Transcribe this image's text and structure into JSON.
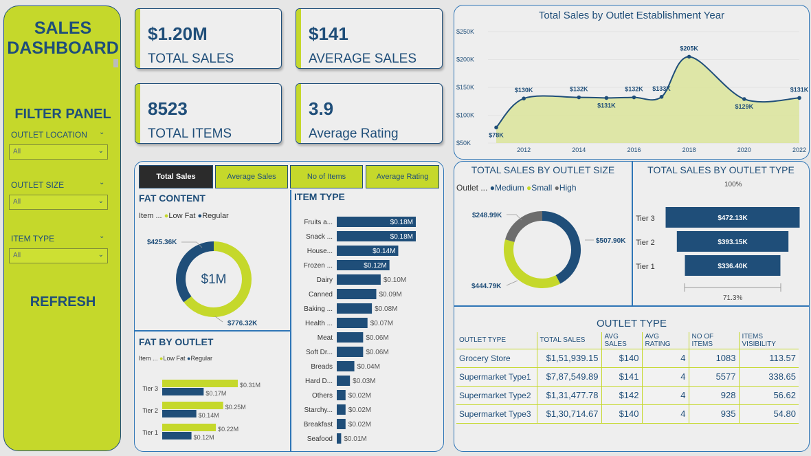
{
  "sidebar": {
    "title_line1": "SALES",
    "title_line2": "DASHBOARD",
    "filter_panel": "FILTER PANEL",
    "filters": [
      {
        "label": "OUTLET LOCATION",
        "value": "All"
      },
      {
        "label": "OUTLET SIZE",
        "value": "All"
      },
      {
        "label": "ITEM TYPE",
        "value": "All"
      }
    ],
    "refresh": "REFRESH"
  },
  "kpis": [
    {
      "value": "$1.20M",
      "label": "TOTAL SALES"
    },
    {
      "value": "$141",
      "label": "AVERAGE SALES"
    },
    {
      "value": "8523",
      "label": "TOTAL ITEMS"
    },
    {
      "value": "3.9",
      "label": "Average Rating"
    }
  ],
  "tabs": [
    "Total Sales",
    "Average Sales",
    "No of Items",
    "Average Rating"
  ],
  "fat_content": {
    "title": "FAT CONTENT",
    "legend_title": "Item ...",
    "legend": [
      "Low Fat",
      "Regular"
    ],
    "center": "$1M",
    "label_regular": "$425.36K",
    "label_lowfat": "$776.32K"
  },
  "fat_by_outlet": {
    "title": "FAT BY OUTLET",
    "legend_title": "Item ...",
    "legend": [
      "Low Fat",
      "Regular"
    ],
    "rows": [
      {
        "tier": "Tier 3",
        "lowfat": "$0.31M",
        "regular": "$0.17M"
      },
      {
        "tier": "Tier 2",
        "lowfat": "$0.25M",
        "regular": "$0.14M"
      },
      {
        "tier": "Tier 1",
        "lowfat": "$0.22M",
        "regular": "$0.12M"
      }
    ]
  },
  "item_type": {
    "title": "ITEM TYPE",
    "rows": [
      {
        "name": "Fruits a...",
        "value": "$0.18M"
      },
      {
        "name": "Snack ...",
        "value": "$0.18M"
      },
      {
        "name": "House...",
        "value": "$0.14M"
      },
      {
        "name": "Frozen ...",
        "value": "$0.12M"
      },
      {
        "name": "Dairy",
        "value": "$0.10M"
      },
      {
        "name": "Canned",
        "value": "$0.09M"
      },
      {
        "name": "Baking ...",
        "value": "$0.08M"
      },
      {
        "name": "Health ...",
        "value": "$0.07M"
      },
      {
        "name": "Meat",
        "value": "$0.06M"
      },
      {
        "name": "Soft Dr...",
        "value": "$0.06M"
      },
      {
        "name": "Breads",
        "value": "$0.04M"
      },
      {
        "name": "Hard D...",
        "value": "$0.03M"
      },
      {
        "name": "Others",
        "value": "$0.02M"
      },
      {
        "name": "Starchy...",
        "value": "$0.02M"
      },
      {
        "name": "Breakfast",
        "value": "$0.02M"
      },
      {
        "name": "Seafood",
        "value": "$0.01M"
      }
    ]
  },
  "line_chart": {
    "title": "Total Sales by Outlet Establishment Year",
    "y_ticks": [
      "$250K",
      "$200K",
      "$150K",
      "$100K",
      "$50K"
    ],
    "x_ticks": [
      "2012",
      "2014",
      "2016",
      "2018",
      "2020",
      "2022"
    ],
    "point_labels": [
      "$78K",
      "$130K",
      "$132K",
      "$131K",
      "$132K",
      "$133K",
      "$205K",
      "$129K",
      "$131K"
    ]
  },
  "outlet_size": {
    "title": "TOTAL SALES BY OUTLET SIZE",
    "legend_title": "Outlet ...",
    "legend": [
      "Medium",
      "Small",
      "High"
    ],
    "label_high": "$248.99K",
    "label_medium": "$507.90K",
    "label_small": "$444.79K"
  },
  "outlet_type_funnel": {
    "title": "TOTAL SALES BY OUTLET TYPE",
    "top_pct": "100%",
    "bottom_pct": "71.3%",
    "rows": [
      {
        "tier": "Tier 3",
        "value": "$472.13K"
      },
      {
        "tier": "Tier 2",
        "value": "$393.15K"
      },
      {
        "tier": "Tier 1",
        "value": "$336.40K"
      }
    ]
  },
  "outlet_table": {
    "title": "OUTLET TYPE",
    "headers": [
      "OUTLET TYPE",
      "TOTAL SALES",
      "AVG SALES",
      "AVG RATING",
      "NO OF ITEMS",
      "ITEMS VISIBILITY"
    ],
    "rows": [
      [
        "Grocery Store",
        "$1,51,939.15",
        "$140",
        "4",
        "1083",
        "113.57"
      ],
      [
        "Supermarket Type1",
        "$7,87,549.89",
        "$141",
        "4",
        "5577",
        "338.65"
      ],
      [
        "Supermarket Type2",
        "$1,31,477.78",
        "$142",
        "4",
        "928",
        "56.62"
      ],
      [
        "Supermarket Type3",
        "$1,30,714.67",
        "$140",
        "4",
        "935",
        "54.80"
      ]
    ]
  },
  "colors": {
    "accent": "#c5d82b",
    "navy": "#1f4e79",
    "grey": "#6d6d6d"
  },
  "chart_data": [
    {
      "type": "line",
      "title": "Total Sales by Outlet Establishment Year",
      "x": [
        2011,
        2012,
        2014,
        2015,
        2016,
        2017,
        2018,
        2020,
        2022
      ],
      "y": [
        78,
        130,
        132,
        131,
        132,
        133,
        205,
        129,
        131
      ],
      "ylim": [
        50,
        250
      ],
      "xlabel": "",
      "ylabel": ""
    },
    {
      "type": "pie",
      "title": "FAT CONTENT",
      "categories": [
        "Low Fat",
        "Regular"
      ],
      "values": [
        776.32,
        425.36
      ]
    },
    {
      "type": "pie",
      "title": "TOTAL SALES BY OUTLET SIZE",
      "categories": [
        "Medium",
        "Small",
        "High"
      ],
      "values": [
        507.9,
        444.79,
        248.99
      ]
    },
    {
      "type": "bar",
      "title": "ITEM TYPE",
      "categories": [
        "Fruits a...",
        "Snack ...",
        "House...",
        "Frozen ...",
        "Dairy",
        "Canned",
        "Baking ...",
        "Health ...",
        "Meat",
        "Soft Dr...",
        "Breads",
        "Hard D...",
        "Others",
        "Starchy...",
        "Breakfast",
        "Seafood"
      ],
      "values": [
        0.18,
        0.18,
        0.14,
        0.12,
        0.1,
        0.09,
        0.08,
        0.07,
        0.06,
        0.06,
        0.04,
        0.03,
        0.02,
        0.02,
        0.02,
        0.01
      ]
    },
    {
      "type": "bar",
      "title": "FAT BY OUTLET",
      "categories": [
        "Tier 3",
        "Tier 2",
        "Tier 1"
      ],
      "series": [
        {
          "name": "Low Fat",
          "values": [
            0.31,
            0.25,
            0.22
          ]
        },
        {
          "name": "Regular",
          "values": [
            0.17,
            0.14,
            0.12
          ]
        }
      ]
    },
    {
      "type": "bar",
      "title": "TOTAL SALES BY OUTLET TYPE",
      "categories": [
        "Tier 3",
        "Tier 2",
        "Tier 1"
      ],
      "values": [
        472.13,
        393.15,
        336.4
      ]
    }
  ]
}
